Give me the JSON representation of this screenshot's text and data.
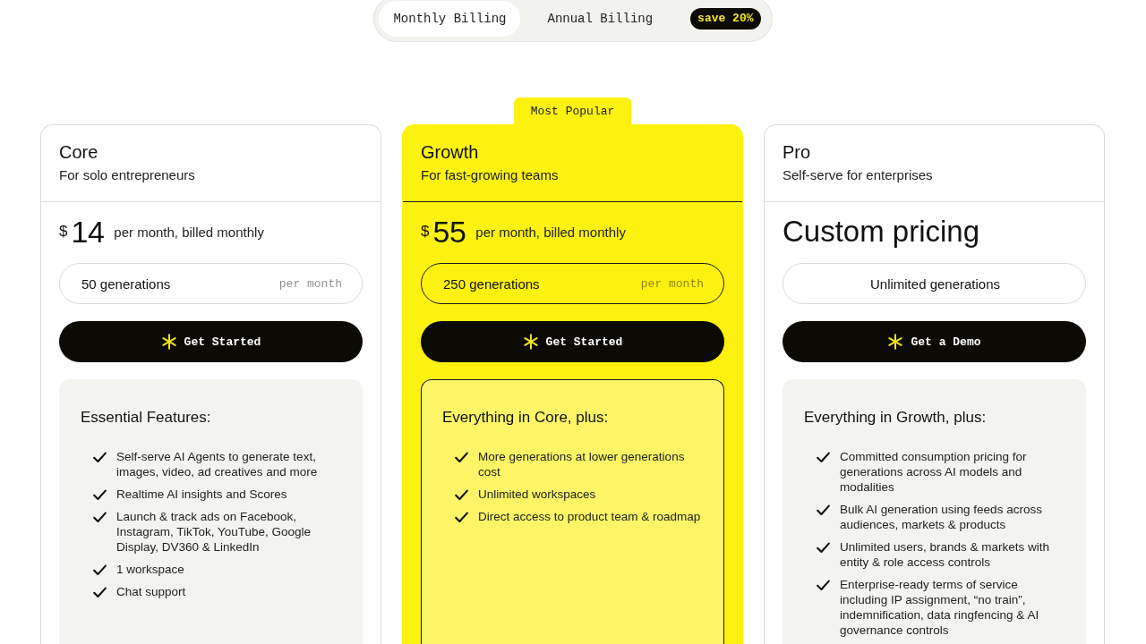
{
  "billing_toggle": {
    "options": [
      {
        "label": "Monthly Billing",
        "selected": true
      },
      {
        "label": "Annual Billing",
        "selected": false
      }
    ],
    "badge": "save 20%"
  },
  "plans": [
    {
      "name": "Core",
      "tagline": "For solo entrepreneurs",
      "highlighted": false,
      "price": {
        "kind": "amount",
        "currency": "$",
        "amount": "14",
        "period": "per month, billed monthly"
      },
      "usage": {
        "amount": "50 generations",
        "period": "per month"
      },
      "cta": "Get Started",
      "features_title": "Essential Features:",
      "features": [
        "Self-serve AI Agents to generate text, images, video, ad creatives and more",
        "Realtime AI insights and Scores",
        "Launch & track ads on Facebook, Instagram, TikTok, YouTube, Google Display, DV360 & LinkedIn",
        "1 workspace",
        "Chat support"
      ]
    },
    {
      "name": "Growth",
      "ribbon": "Most Popular",
      "tagline": "For fast-growing teams",
      "highlighted": true,
      "price": {
        "kind": "amount",
        "currency": "$",
        "amount": "55",
        "period": "per month, billed monthly"
      },
      "usage": {
        "amount": "250 generations",
        "period": "per month"
      },
      "cta": "Get Started",
      "features_title": "Everything in Core, plus:",
      "features": [
        "More generations at lower generations cost",
        "Unlimited workspaces",
        "Direct access to product team & roadmap"
      ]
    },
    {
      "name": "Pro",
      "tagline": "Self-serve for enterprises",
      "highlighted": false,
      "price": {
        "kind": "custom",
        "text": "Custom pricing"
      },
      "usage": {
        "amount": "Unlimited generations"
      },
      "cta": "Get a Demo",
      "features_title": "Everything in Growth, plus:",
      "features": [
        "Committed consumption pricing for generations across AI models and modalities",
        "Bulk AI generation using feeds across audiences, markets & products",
        "Unlimited users, brands & markets with entity & role access controls",
        "Enterprise-ready terms of service including IP assignment, “no train”, indemnification, data ringfencing & AI governance controls"
      ]
    }
  ]
}
